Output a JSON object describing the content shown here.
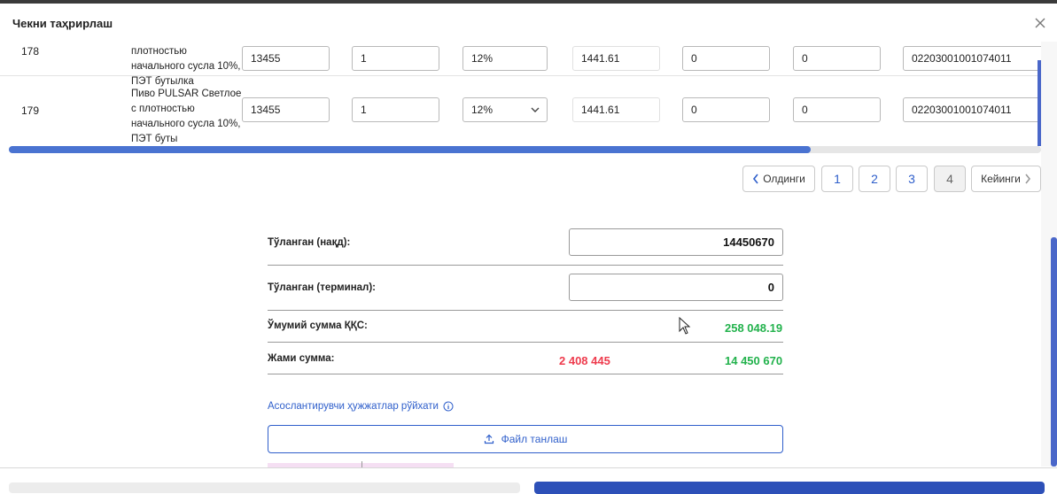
{
  "header": {
    "title": "Чекни таҳрирлаш"
  },
  "rows": [
    {
      "num": "178",
      "name": "плотностью начального сусла 10%, ПЭТ бутылка",
      "price": "13455",
      "qty": "1",
      "vat": "12%",
      "vat_sum": "1441.61",
      "discount": "0",
      "other": "0",
      "code": "02203001001074011"
    },
    {
      "num": "179",
      "name": "Пиво PULSAR Светлое с плотностью начального сусла 10%, ПЭТ буты",
      "price": "13455",
      "qty": "1",
      "vat": "12%",
      "vat_sum": "1441.61",
      "discount": "0",
      "other": "0",
      "code": "02203001001074011"
    }
  ],
  "pagination": {
    "prev": "Олдинги",
    "next": "Кейинги",
    "pages": [
      "1",
      "2",
      "3",
      "4"
    ],
    "active": "4"
  },
  "summary": {
    "paid_cash_label": "Тўланган (нақд):",
    "paid_cash_value": "14450670",
    "paid_terminal_label": "Тўланган (терминал):",
    "paid_terminal_value": "0",
    "total_vat_label": "Ўмумий сумма ҚҚС:",
    "total_vat_value": "258 048.19",
    "total_label": "Жами сумма:",
    "total_diff": "2 408 445",
    "total_value": "14 450 670"
  },
  "docs": {
    "link_label": "Асослантирувчи ҳужжатлар рўйхати",
    "file_button": "Файл танлаш"
  },
  "colors": {
    "accent": "#2f5fcb",
    "green": "#22b24c",
    "red": "#ee3b4d"
  }
}
